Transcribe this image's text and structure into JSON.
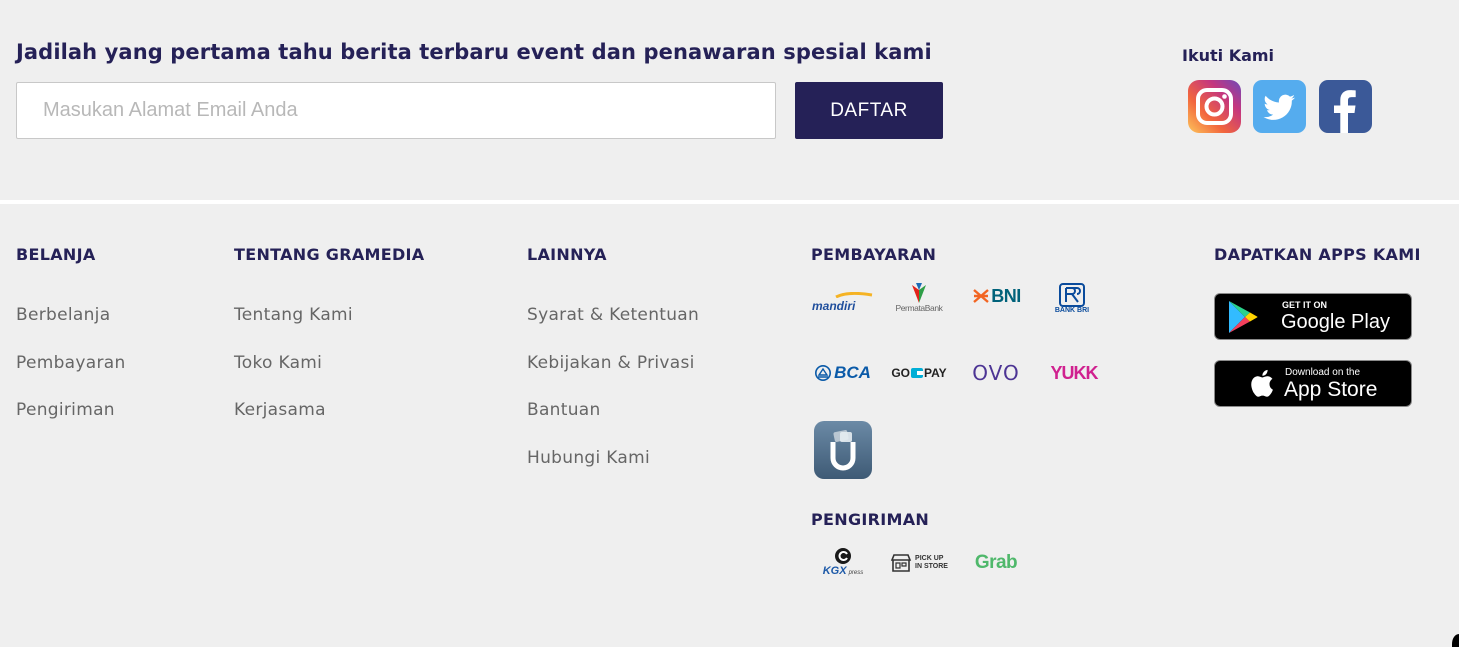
{
  "newsletter": {
    "title": "Jadilah yang pertama tahu berita terbaru event dan penawaran spesial kami",
    "email_placeholder": "Masukan Alamat Email Anda",
    "email_value": "",
    "submit_label": "DAFTAR"
  },
  "social": {
    "label": "Ikuti Kami",
    "items": [
      {
        "name": "instagram-icon",
        "color": "#c13584"
      },
      {
        "name": "twitter-icon",
        "color": "#55acee"
      },
      {
        "name": "facebook-icon",
        "color": "#3b5998"
      }
    ]
  },
  "columns": {
    "belanja": {
      "title": "BELANJA",
      "links": [
        "Berbelanja",
        "Pembayaran",
        "Pengiriman"
      ]
    },
    "tentang": {
      "title": "TENTANG GRAMEDIA",
      "links": [
        "Tentang Kami",
        "Toko Kami",
        "Kerjasama"
      ]
    },
    "lainnya": {
      "title": "LAINNYA",
      "links": [
        "Syarat & Ketentuan",
        "Kebijakan & Privasi",
        "Bantuan",
        "Hubungi Kami"
      ]
    }
  },
  "payment": {
    "title": "PEMBAYARAN",
    "logos": {
      "mandiri": "mandiri",
      "permata": "PermataBank",
      "bni": "BNI",
      "bri": "BANK BRI",
      "bca": "BCA",
      "gopay_left": "GO",
      "gopay_right": "PAY",
      "ovo": "OVO",
      "yukk": "YUKK"
    }
  },
  "shipping": {
    "title": "PENGIRIMAN",
    "logos": {
      "kgx": "KGX",
      "kgx_sub": "press",
      "pickup_line1": "PICK UP",
      "pickup_line2": "IN STORE",
      "grab": "Grab"
    }
  },
  "apps": {
    "title": "DAPATKAN APPS KAMI",
    "google_small": "GET IT ON",
    "google_big": "Google Play",
    "apple_small": "Download on the",
    "apple_big": "App Store"
  },
  "colors": {
    "brand_navy": "#252157",
    "background": "#efefef"
  }
}
